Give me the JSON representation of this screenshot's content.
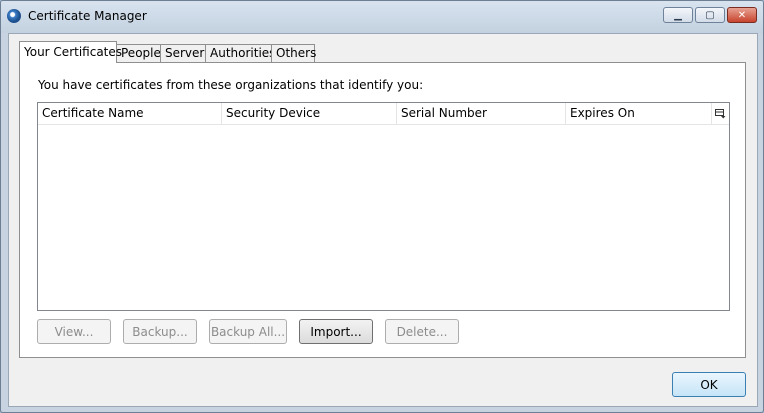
{
  "window": {
    "title": "Certificate Manager",
    "controls": {
      "minimize": "▁",
      "maximize": "▢",
      "close": "✕"
    }
  },
  "tabs": [
    {
      "label": "Your Certificates",
      "active": true
    },
    {
      "label": "People",
      "active": false
    },
    {
      "label": "Servers",
      "active": false
    },
    {
      "label": "Authorities",
      "active": false
    },
    {
      "label": "Others",
      "active": false
    }
  ],
  "panel": {
    "intro": "You have certificates from these organizations that identify you:",
    "columns": [
      "Certificate Name",
      "Security Device",
      "Serial Number",
      "Expires On"
    ],
    "column_picker_icon": "column-picker-icon",
    "rows": []
  },
  "buttons": {
    "view": "View...",
    "backup": "Backup...",
    "backup_all": "Backup All...",
    "import": "Import...",
    "delete": "Delete..."
  },
  "ok": "OK",
  "colors": {
    "accent": "#3c7fb1",
    "disabled_text": "#8c8c8c"
  }
}
